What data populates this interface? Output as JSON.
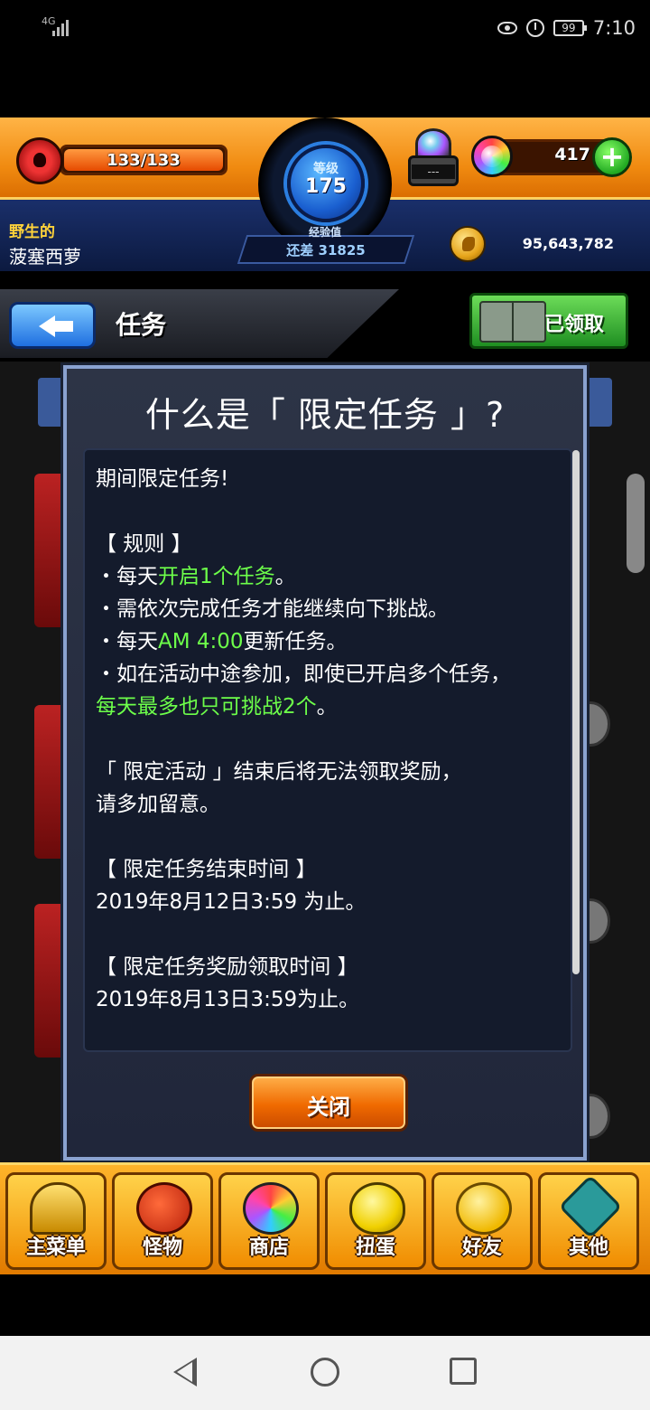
{
  "status_bar": {
    "signal": "4G",
    "battery": "99",
    "time": "7:10"
  },
  "header": {
    "hp": "133/133",
    "rank_label": "等级",
    "rank_value": "175",
    "exp_label": "经验值",
    "exp_remaining": "还差 31825",
    "gem_machine_text": "---",
    "orb_count": "417",
    "orb_plus": "+",
    "user_label": "野生的",
    "user_name": "菠塞西萝",
    "coin_count": "95,643,782"
  },
  "title_bar": {
    "title": "任务",
    "claimed_label": "已领取"
  },
  "modal": {
    "title": "什么是「 限定任务 」?",
    "lines": {
      "intro": "期间限定任务!",
      "rules_header": "【 规则 】",
      "rule1_prefix": "・每天",
      "rule1_green": "开启1个任务",
      "rule1_suffix": "。",
      "rule2": "・需依次完成任务才能继续向下挑战。",
      "rule3_prefix": "・每天",
      "rule3_green": "AM 4:00",
      "rule3_suffix": "更新任务。",
      "rule4": "・如在活动中途参加，即使已开启多个任务，",
      "rule4_green": "每天最多也只可挑战2个",
      "rule4_suffix": "。",
      "notice1": "「 限定活动 」结束后将无法领取奖励，",
      "notice2": "请多加留意。",
      "end_header": "【 限定任务结束时间 】",
      "end_time": "2019年8月12日3:59 为止。",
      "reward_header": "【 限定任务奖励领取时间 】",
      "reward_time": "2019年8月13日3:59为止。"
    },
    "close_label": "关闭"
  },
  "bottom_nav": [
    {
      "label": "主菜单",
      "icon": "home-castle-icon"
    },
    {
      "label": "怪物",
      "icon": "monster-icon"
    },
    {
      "label": "商店",
      "icon": "rainbow-orb-icon"
    },
    {
      "label": "扭蛋",
      "icon": "egg-icon"
    },
    {
      "label": "好友",
      "icon": "friends-icon"
    },
    {
      "label": "其他",
      "icon": "other-icon"
    }
  ],
  "colors": {
    "accent_orange": "#f08a10",
    "highlight_green": "#6dff4a",
    "modal_border": "#8aa2d0"
  }
}
